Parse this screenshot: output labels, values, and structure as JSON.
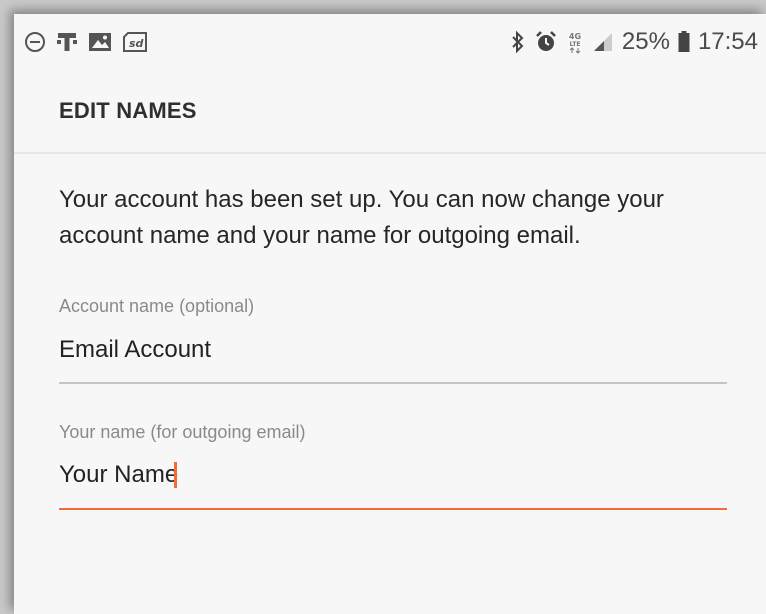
{
  "status_bar": {
    "left_icons": [
      "do-not-disturb-icon",
      "t-mobile-icon",
      "gallery-icon",
      "sd-card-icon"
    ],
    "right_icons": [
      "bluetooth-icon",
      "alarm-icon",
      "4g-lte-icon",
      "signal-icon",
      "battery-icon"
    ],
    "network": "4G LTE",
    "battery_percent": "25%",
    "time": "17:54"
  },
  "header": {
    "title": "EDIT NAMES"
  },
  "main": {
    "intro": "Your account has been set up. You can now change your account name and your name for outgoing email.",
    "account_field": {
      "label": "Account name (optional)",
      "value": "Email Account"
    },
    "name_field": {
      "label": "Your name (for outgoing email)",
      "value": "Your Name"
    }
  },
  "colors": {
    "accent": "#f26b38",
    "background": "#f7f7f7",
    "divider": "#c4c4c4"
  }
}
